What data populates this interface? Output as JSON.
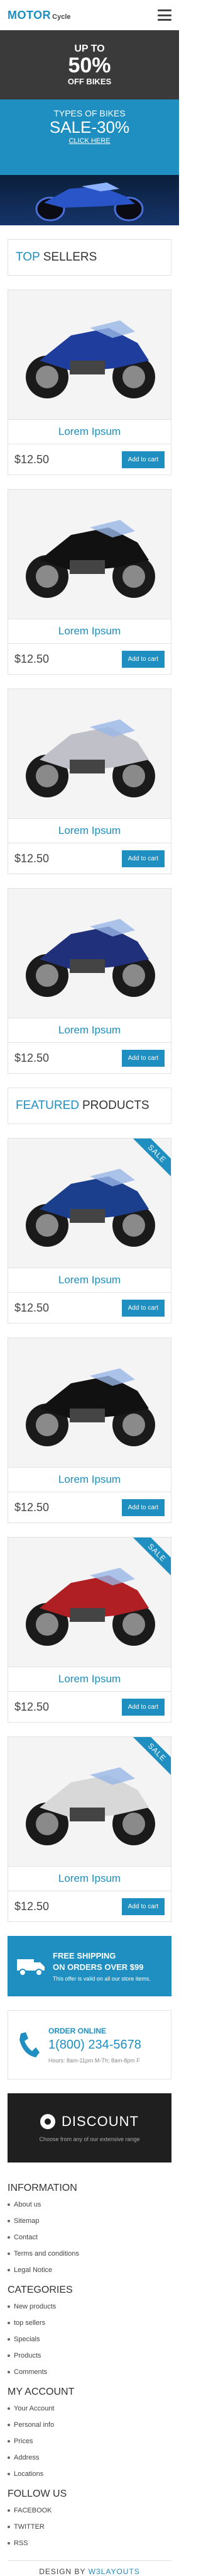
{
  "header": {
    "logo_main": "MOTOR",
    "logo_sub": "Cycle"
  },
  "promo_dark": {
    "line1": "UP TO",
    "line2": "50%",
    "line3": "OFF BIKES"
  },
  "promo_blue": {
    "line1": "TYPES OF BIKES",
    "line2": "SALE-30%",
    "link": "CLICK HERE"
  },
  "top_sellers": {
    "title_accent": "TOP",
    "title_rest": "SELLERS",
    "products": [
      {
        "name": "Lorem Ipsum",
        "price": "$12.50",
        "cart": "Add to cart",
        "color": "#1e3d9c"
      },
      {
        "name": "Lorem Ipsum",
        "price": "$12.50",
        "cart": "Add to cart",
        "color": "#111111"
      },
      {
        "name": "Lorem Ipsum",
        "price": "$12.50",
        "cart": "Add to cart",
        "color": "#c0c0c8"
      },
      {
        "name": "Lorem Ipsum",
        "price": "$12.50",
        "cart": "Add to cart",
        "color": "#20307a"
      }
    ]
  },
  "featured": {
    "title_accent": "FEATURED",
    "title_rest": "PRODUCTS",
    "products": [
      {
        "name": "Lorem Ipsum",
        "price": "$12.50",
        "cart": "Add to cart",
        "sale": "SALE",
        "color": "#1b3f8c"
      },
      {
        "name": "Lorem Ipsum",
        "price": "$12.50",
        "cart": "Add to cart",
        "sale": "",
        "color": "#111111"
      },
      {
        "name": "Lorem Ipsum",
        "price": "$12.50",
        "cart": "Add to cart",
        "sale": "SALE",
        "color": "#b01f24"
      },
      {
        "name": "Lorem Ipsum",
        "price": "$12.50",
        "cart": "Add to cart",
        "sale": "SALE",
        "color": "#d8d8d8"
      }
    ]
  },
  "shipping": {
    "line1": "FREE SHIPPING",
    "line2": "ON ORDERS OVER $99",
    "line3": "This offer is valid on all our store items."
  },
  "phone": {
    "line1": "ORDER ONLINE",
    "line2": "1(800) 234-5678",
    "line3": "Hours: 8am-11pm M-Th; 8am-8pm F"
  },
  "discount": {
    "title": "DISCOUNT",
    "text": "Choose from any of our extensive range"
  },
  "footer": {
    "information_title": "INFORMATION",
    "information": [
      "About us",
      "Sitemap",
      "Contact",
      "Terms and conditions",
      "Legal Notice"
    ],
    "categories_title": "CATEGORIES",
    "categories": [
      "New products",
      "top sellers",
      "Specials",
      "Products",
      "Comments"
    ],
    "account_title": "MY ACCOUNT",
    "account": [
      "Your Account",
      "Personal info",
      "Prices",
      "Address",
      "Locations"
    ],
    "follow_title": "FOLLOW US",
    "follow": [
      "FACEBOOK",
      "TWITTER",
      "RSS"
    ],
    "design_label": "DESIGN BY",
    "design_brand": "W3LAYOUTS"
  },
  "colors": {
    "accent": "#1e8fc0",
    "dark": "#3a3a3a",
    "discount_bg": "#1f1f1f"
  }
}
